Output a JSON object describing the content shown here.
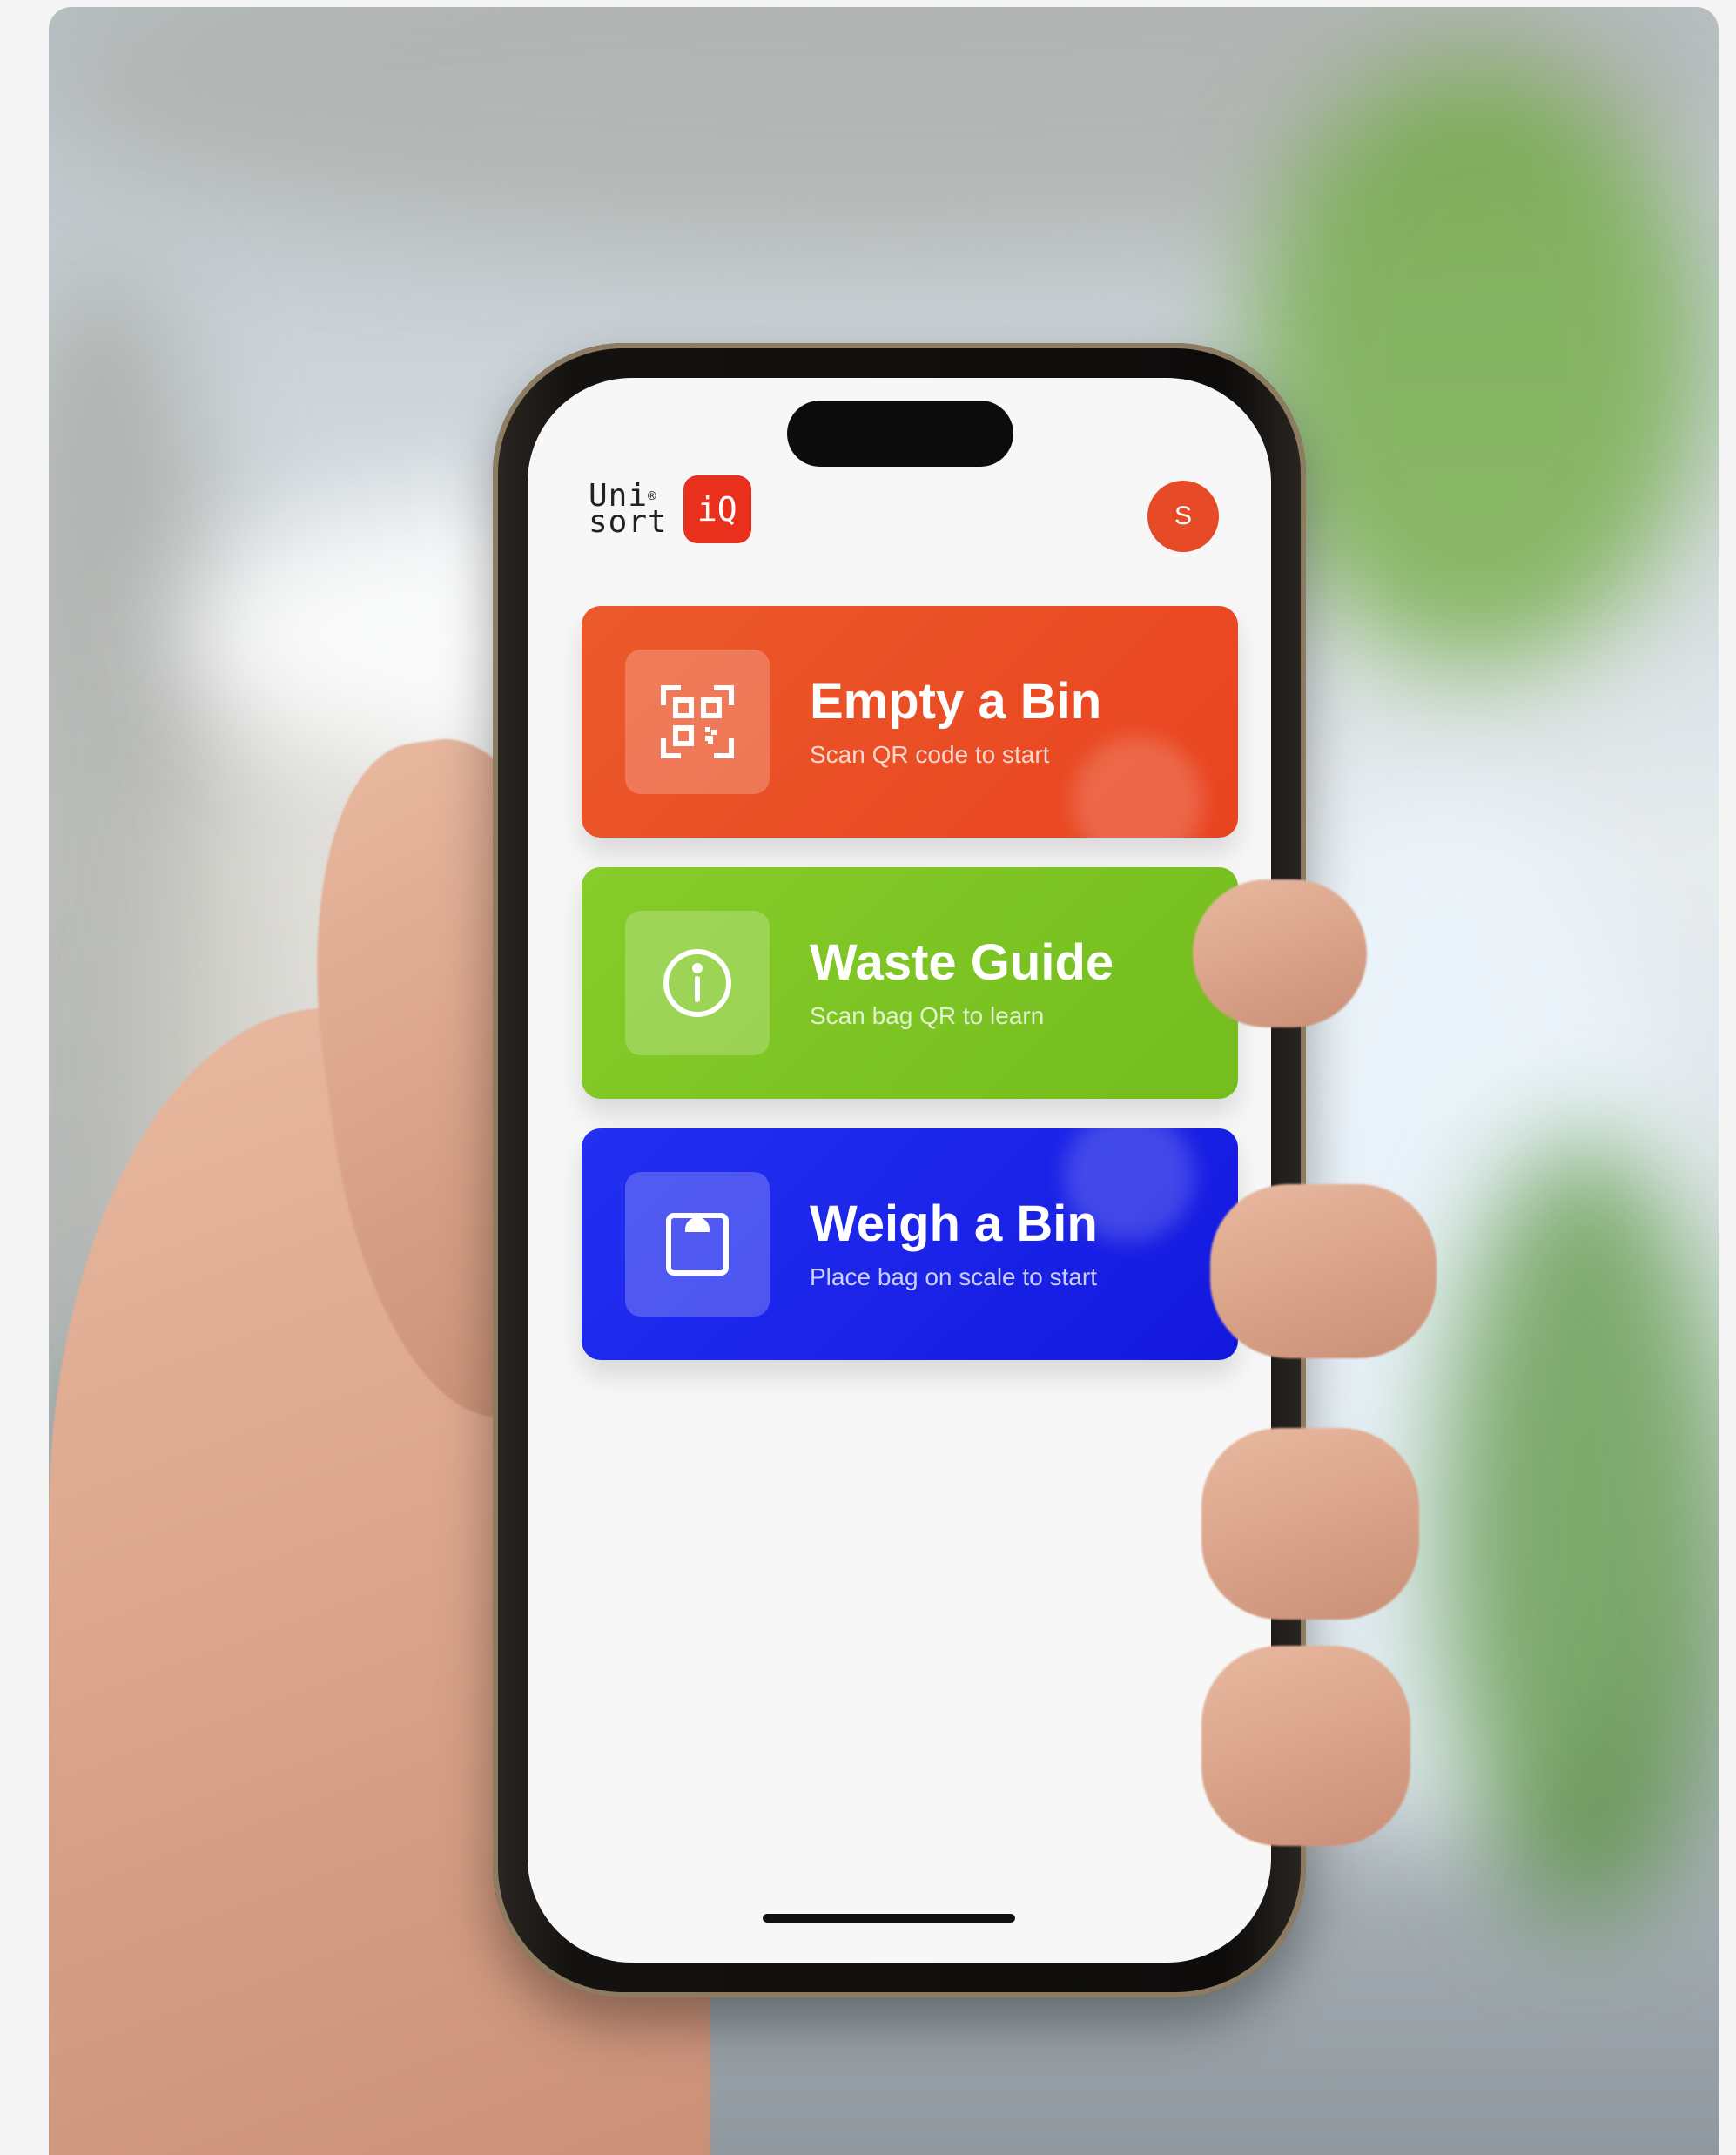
{
  "colors": {
    "brand_red": "#e8301c",
    "avatar_orange": "#e74a26",
    "empty_card": "#e84a22",
    "guide_card": "#7fc524",
    "weigh_card": "#1a24e8"
  },
  "header": {
    "logo_line1": "Uni",
    "logo_line2": "sort",
    "logo_reg": "®",
    "logo_badge": "iQ",
    "avatar_initial": "S"
  },
  "cards": [
    {
      "title": "Empty a Bin",
      "subtitle": "Scan QR code to start",
      "icon": "qr-code-icon",
      "color": "#e84a22"
    },
    {
      "title": "Waste Guide",
      "subtitle": "Scan bag QR to learn",
      "icon": "info-icon",
      "color": "#7fc524"
    },
    {
      "title": "Weigh a Bin",
      "subtitle": "Place bag on scale to start",
      "icon": "scale-icon",
      "color": "#1a24e8"
    }
  ]
}
